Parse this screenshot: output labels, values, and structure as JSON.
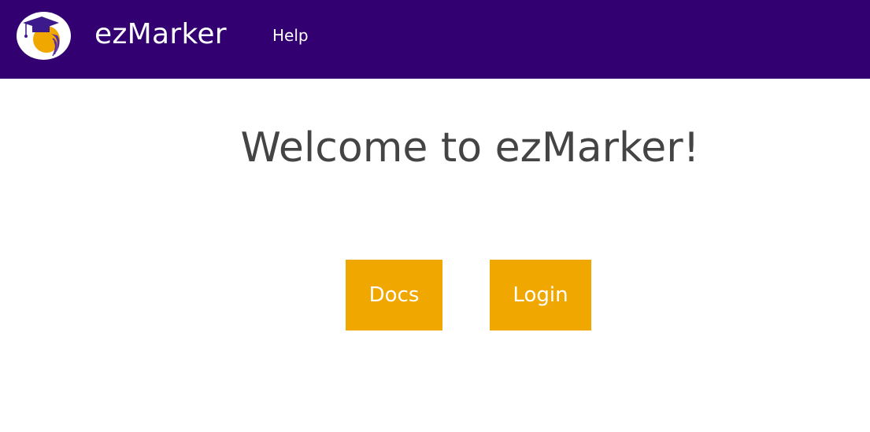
{
  "header": {
    "logo_icon": "graduation-cap-logo-icon",
    "brand": "ezMarker",
    "nav_items": [
      {
        "label": "Help"
      }
    ]
  },
  "main": {
    "title": "Welcome to ezMarker!",
    "buttons": {
      "docs_label": "Docs",
      "login_label": "Login"
    }
  },
  "colors": {
    "header_bg": "#330072",
    "button_bg": "#f0a800",
    "title_text": "#444444",
    "logo_orange": "#f0a800",
    "logo_purple": "#5a2ca0"
  }
}
